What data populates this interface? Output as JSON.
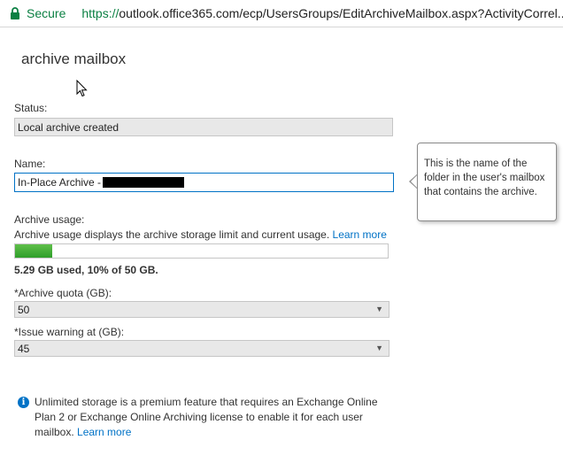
{
  "browser": {
    "secure_label": "Secure",
    "url_scheme": "https://",
    "url_rest": "outlook.office365.com/ecp/UsersGroups/EditArchiveMailbox.aspx?ActivityCorrel..."
  },
  "page": {
    "title": "archive mailbox"
  },
  "status": {
    "label": "Status:",
    "value": "Local archive created"
  },
  "name": {
    "label": "Name:",
    "value": "In-Place Archive -"
  },
  "tooltip": {
    "text": "This is the name of the folder in the user's mailbox that contains the archive."
  },
  "archive_usage": {
    "label": "Archive usage:",
    "description": "Archive usage displays the archive storage limit and current usage.",
    "learn_more": "Learn more",
    "used_text": "5.29 GB used, 10% of 50 GB.",
    "percent_used": 10
  },
  "archive_quota": {
    "label": "*Archive quota (GB):",
    "value": "50"
  },
  "issue_warning": {
    "label": "*Issue warning at (GB):",
    "value": "45"
  },
  "info": {
    "text": "Unlimited storage is a premium feature that requires an Exchange Online Plan 2 or Exchange Online Archiving license to enable it for each user mailbox.",
    "learn_more": "Learn more"
  },
  "colors": {
    "accent": "#0072c6",
    "secure_green": "#0b8043",
    "progress_green": "#2f9e2a"
  }
}
